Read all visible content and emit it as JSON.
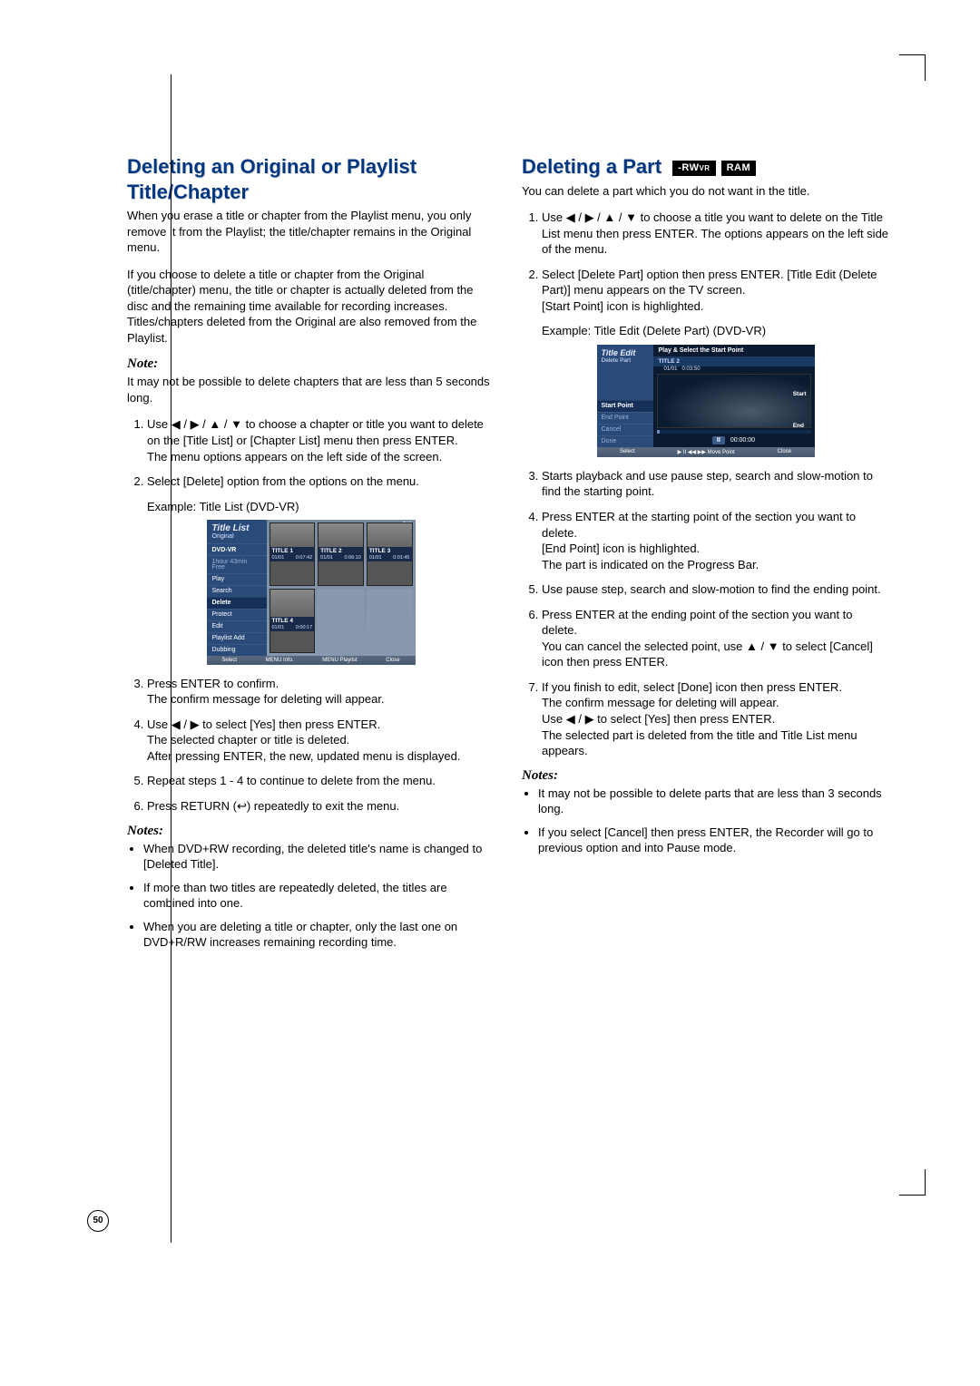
{
  "page_number": "50",
  "left": {
    "heading": "Deleting an Original or Playlist Title/Chapter",
    "p1": "When you erase a title or chapter from the Playlist menu, you only remove it from the Playlist; the title/chapter remains in the Original menu.",
    "p2": "If you choose to delete a title or chapter from the Original (title/chapter) menu, the title or chapter is actually deleted from the disc and the remaining time available for recording increases. Titles/chapters deleted from the Original are also removed from the Playlist.",
    "note_h": "Note:",
    "note1": "It may not be possible to delete chapters that are less than 5 seconds long.",
    "step1": "Use ◀ / ▶ / ▲ / ▼ to choose a chapter or title you want to delete on the [Title List] or [Chapter List] menu then press ENTER.\nThe menu options appears on the left side of the screen.",
    "step2": "Select [Delete] option from the options on the menu.",
    "example_a": "Example: Title List (DVD-VR)",
    "step3": "Press ENTER to confirm.\nThe confirm message for deleting will appear.",
    "step4": "Use ◀ / ▶ to select [Yes] then press ENTER.\nThe selected chapter or title is deleted.\nAfter pressing ENTER, the new, updated menu is displayed.",
    "step5": "Repeat steps 1 - 4 to continue to delete from the menu.",
    "step6": "Press RETURN (↩) repeatedly to exit the menu.",
    "notes_h": "Notes:",
    "bul1": "When DVD+RW recording, the deleted title's name is changed to [Deleted Title].",
    "bul2": "If more than two titles are repeatedly deleted, the titles are combined into one.",
    "bul3": "When you are deleting a title or chapter, only the last one on DVD+R/RW increases remaining recording time."
  },
  "right": {
    "heading": "Deleting a Part",
    "badge1": "-RW",
    "badge1_sub": "VR",
    "badge2": "RAM",
    "p1": "You can delete a part which you do not want in the title.",
    "step1": "Use ◀ / ▶ / ▲ / ▼ to choose a title you want to delete on the Title List menu then press ENTER. The options appears on the left side of the menu.",
    "step2": "Select [Delete Part] option then press ENTER. [Title Edit (Delete Part)] menu appears on the TV screen.\n[Start Point] icon is highlighted.",
    "example_b": "Example: Title Edit (Delete Part) (DVD-VR)",
    "step3": "Starts playback and use pause step, search and slow-motion to find the starting point.",
    "step4": "Press ENTER at the starting point of the section you want to delete.\n[End Point] icon is highlighted.\nThe part is indicated on the Progress Bar.",
    "step5": "Use pause step, search and slow-motion to find the ending point.",
    "step6": "Press ENTER at the ending point of the section you want to delete.\nYou can cancel the selected point, use ▲ / ▼ to select [Cancel] icon then press ENTER.",
    "step7": "If you finish to edit, select [Done] icon then press ENTER.\nThe confirm message for deleting will appear.\nUse ◀ / ▶ to select [Yes] then press ENTER.\nThe selected part is deleted from the title and Title List menu appears.",
    "notes_h": "Notes:",
    "bul1": "It may not be possible to delete parts that are less than 3 seconds long.",
    "bul2": "If you select [Cancel] then press ENTER, the Recorder will go to previous option and into Pause mode."
  },
  "fig_titlelist": {
    "title": "Title List",
    "sub": "Original",
    "disc": "DVD-VR",
    "info1": "1hour 43min",
    "info2": "Free",
    "menu": [
      "Play",
      "Search",
      "Delete",
      "Protect",
      "Edit",
      "Playlist Add",
      "Dubbing"
    ],
    "selected": "Delete",
    "cards": [
      {
        "name": "TITLE 1",
        "a": "01/01",
        "b": "0:07:42"
      },
      {
        "name": "TITLE 2",
        "a": "01/01",
        "b": "0:06:10"
      },
      {
        "name": "TITLE 3",
        "a": "01/01",
        "b": "0:01:45"
      },
      {
        "name": "TITLE 4",
        "a": "01/01",
        "b": "0:00:17"
      }
    ],
    "count": "3/4",
    "bottom": [
      "Select",
      "MENU Info.",
      "MENU Playlist",
      "Close"
    ]
  },
  "fig_deletepart": {
    "title": "Title Edit",
    "sub": "Delete Part",
    "menu": [
      "Start Point",
      "End Point",
      "Cancel",
      "Done"
    ],
    "selected": "Start Point",
    "header": "Play & Select the Start Point",
    "clip_name": "TITLE 2",
    "clip_meta_a": "01/01",
    "clip_meta_b": "0:03:50",
    "side_labels": [
      "Start",
      "End"
    ],
    "ctrl_time": "00:00:00",
    "bottom": [
      "Select",
      "▶ II ◀◀ ▶▶ Move Point",
      "Close"
    ]
  }
}
